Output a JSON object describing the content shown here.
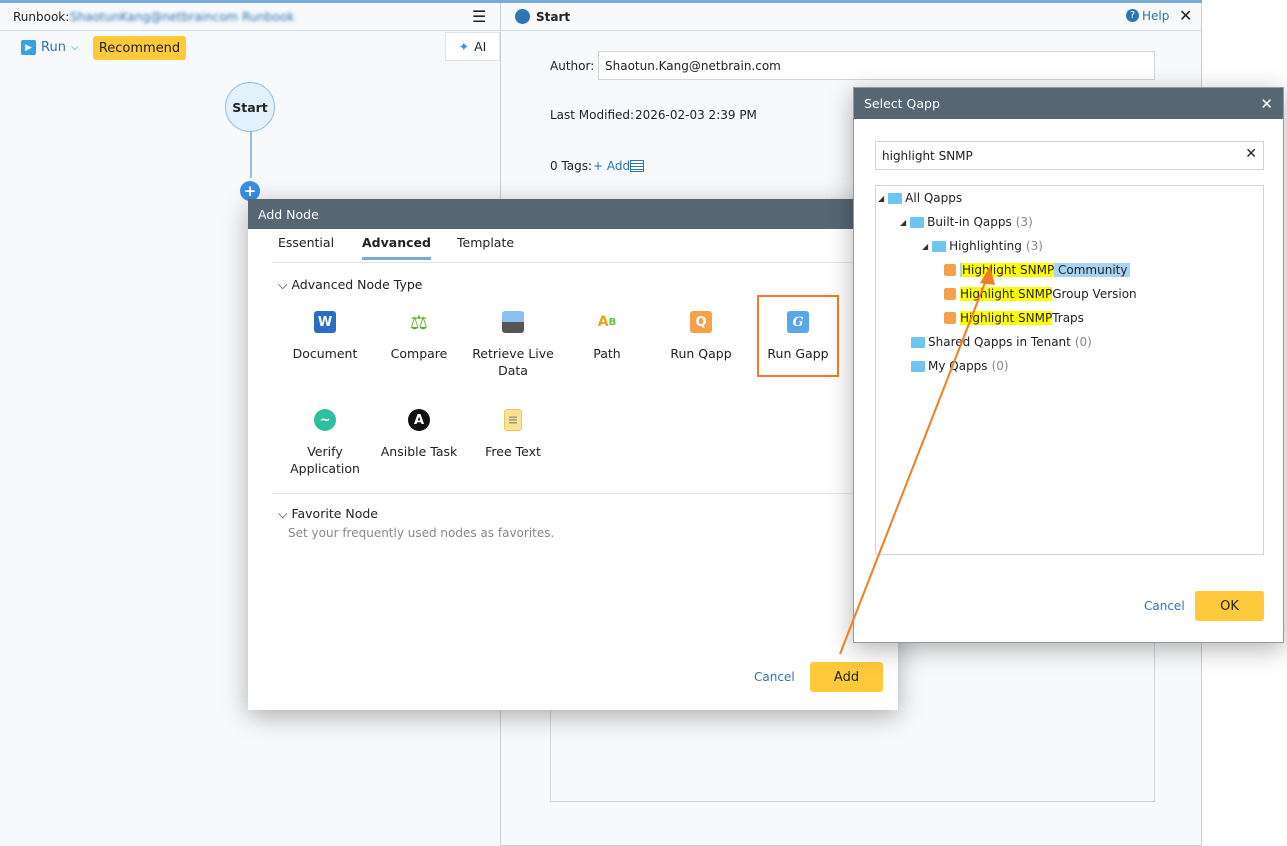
{
  "left": {
    "runbook_label": "Runbook:",
    "runbook_name": "ShaotunKang@netbraincom Runbook",
    "run_label": "Run",
    "recommend_label": "Recommend",
    "ai_label": "AI",
    "start_node": "Start"
  },
  "right": {
    "title": "Start",
    "help_label": "Help",
    "author_label": "Author:",
    "author_value": "Shaotun.Kang@netbrain.com",
    "last_modified_label": "Last Modified:",
    "last_modified_value": "2026-02-03 2:39 PM",
    "tags_label": "0 Tags:",
    "add_tag_label": "+ Add"
  },
  "add_node": {
    "title": "Add Node",
    "tabs": [
      {
        "label": "Essential"
      },
      {
        "label": "Advanced",
        "active": true
      },
      {
        "label": "Template"
      }
    ],
    "section_advanced": "Advanced Node Type",
    "nodes": [
      {
        "label": "Document",
        "icon": "word-document-icon"
      },
      {
        "label": "Compare",
        "icon": "scale-icon"
      },
      {
        "label": "Retrieve Live Data",
        "icon": "retrieve-data-icon"
      },
      {
        "label": "Path",
        "icon": "path-icon"
      },
      {
        "label": "Run Qapp",
        "icon": "qapp-icon"
      },
      {
        "label": "Run Gapp",
        "icon": "gapp-icon",
        "selected": true
      },
      {
        "label": "Verify Application",
        "icon": "verify-icon"
      },
      {
        "label": "Ansible Task",
        "icon": "ansible-icon"
      },
      {
        "label": "Free Text",
        "icon": "note-icon"
      }
    ],
    "section_favorite": "Favorite Node",
    "favorite_hint": "Set your frequently used nodes as favorites.",
    "cancel_label": "Cancel",
    "add_label": "Add"
  },
  "select_qapp": {
    "title": "Select Qapp",
    "search_value": "highlight SNMP",
    "tree": {
      "root": "All Qapps",
      "builtin": "Built-in Qapps",
      "builtin_count": "(3)",
      "highlighting": "Highlighting",
      "highlighting_count": "(3)",
      "items": [
        {
          "match": "Highlight SNMP",
          "rest": " Community",
          "selected": true
        },
        {
          "match": "Highlight SNMP",
          "rest": " Group Version"
        },
        {
          "match": "Highlight SNMP",
          "rest": " Traps"
        }
      ],
      "shared": "Shared Qapps in Tenant",
      "shared_count": "(0)",
      "my": "My Qapps",
      "my_count": "(0)"
    },
    "cancel_label": "Cancel",
    "ok_label": "OK"
  },
  "colors": {
    "accent": "#2f74b5",
    "button": "#ffc93c",
    "dialog_header": "#566673",
    "highlight": "#ffff00",
    "annotation": "#f47c20"
  }
}
